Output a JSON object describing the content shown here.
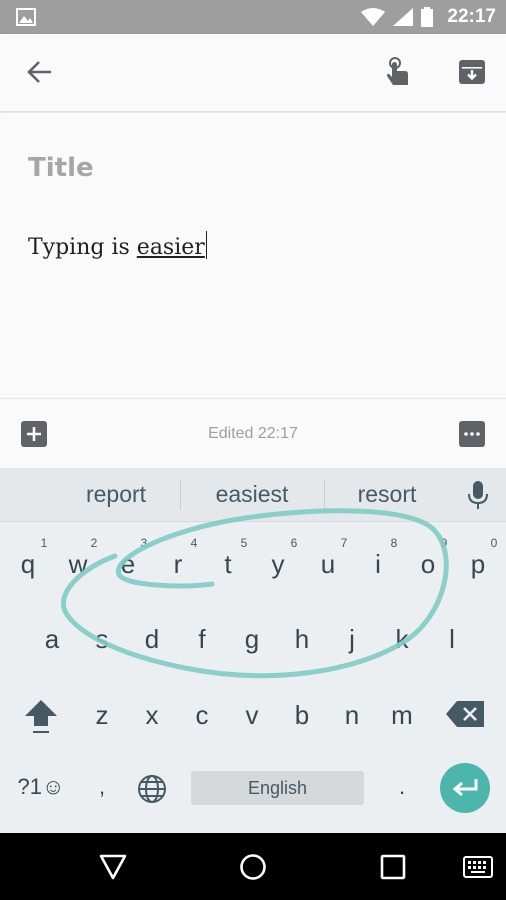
{
  "status_bar": {
    "time": "22:17"
  },
  "toolbar": {
    "back_icon": "arrow-back-icon",
    "pin_icon": "touch-icon",
    "archive_icon": "archive-icon"
  },
  "note": {
    "title_placeholder": "Title",
    "body_text": "Typing is ",
    "composing_word": "easier"
  },
  "bottom_bar": {
    "edited": "Edited 22:17"
  },
  "keyboard": {
    "suggestions": [
      "report",
      "easiest",
      "resort"
    ],
    "row1": [
      "q",
      "w",
      "e",
      "r",
      "t",
      "y",
      "u",
      "i",
      "o",
      "p"
    ],
    "row1_hints": [
      "1",
      "2",
      "3",
      "4",
      "5",
      "6",
      "7",
      "8",
      "9",
      "0"
    ],
    "row2": [
      "a",
      "s",
      "d",
      "f",
      "g",
      "h",
      "j",
      "k",
      "l"
    ],
    "row3": [
      "z",
      "x",
      "c",
      "v",
      "b",
      "n",
      "m"
    ],
    "symbols_key": "?1☺",
    "comma": ",",
    "space_label": "English",
    "period": ".",
    "gesture_trail_color": "#80cbc4",
    "enter_color": "#4db6ac"
  }
}
